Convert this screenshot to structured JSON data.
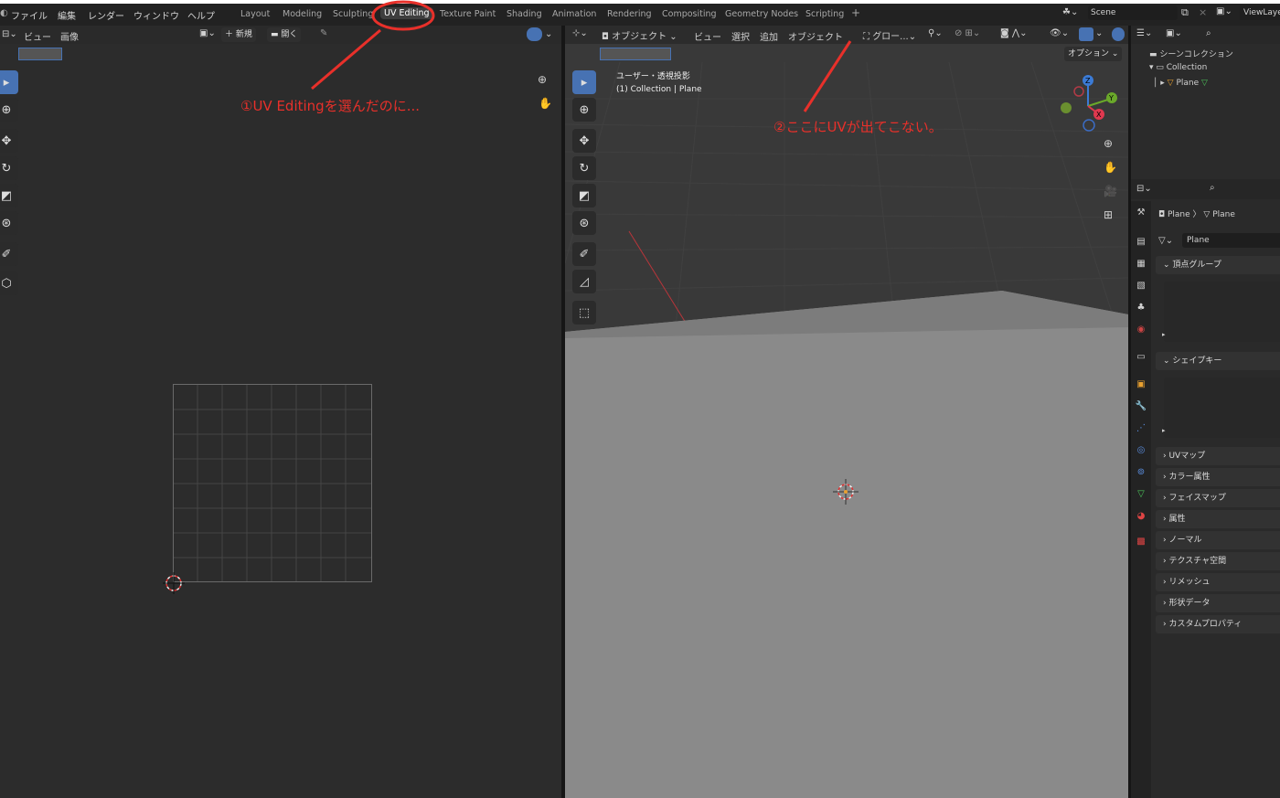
{
  "menu": [
    "ファイル",
    "編集",
    "レンダー",
    "ウィンドウ",
    "ヘルプ"
  ],
  "workspaces": [
    "Layout",
    "Modeling",
    "Sculpting",
    "UV Editing",
    "Texture Paint",
    "Shading",
    "Animation",
    "Rendering",
    "Compositing",
    "Geometry Nodes",
    "Scripting",
    "+"
  ],
  "active_workspace": "UV Editing",
  "scene": "Scene",
  "viewlayer": "ViewLaye",
  "uv_editor": {
    "view": "ビュー",
    "image": "画像",
    "new": "新規",
    "open": "開く"
  },
  "viewport": {
    "mode": "オブジェクト",
    "menus": [
      "ビュー",
      "選択",
      "追加",
      "オブジェクト"
    ],
    "orient": "グロー...",
    "options": "オプション",
    "view_name": "ユーザー・透視投影",
    "collection": "(1) Collection | Plane"
  },
  "outliner": {
    "scene_collection": "シーンコレクション",
    "collection": "Collection",
    "plane": "Plane"
  },
  "properties": {
    "breadcrumb_obj": "Plane",
    "breadcrumb_mesh": "Plane",
    "mesh_name": "Plane",
    "sections": [
      "頂点グループ",
      "シェイプキー",
      "UVマップ",
      "カラー属性",
      "フェイスマップ",
      "属性",
      "ノーマル",
      "テクスチャ空間",
      "リメッシュ",
      "形状データ",
      "カスタムプロパティ"
    ]
  },
  "annotations": {
    "a1": "①UV Editingを選んだのに...",
    "a2": "②ここにUVが出てこない。"
  },
  "colors": {
    "annotation": "#e8302a",
    "active_tool": "#4772b3",
    "x_axis": "#e0384f",
    "y_axis": "#6aa82a",
    "z_axis": "#3b7bd6"
  }
}
